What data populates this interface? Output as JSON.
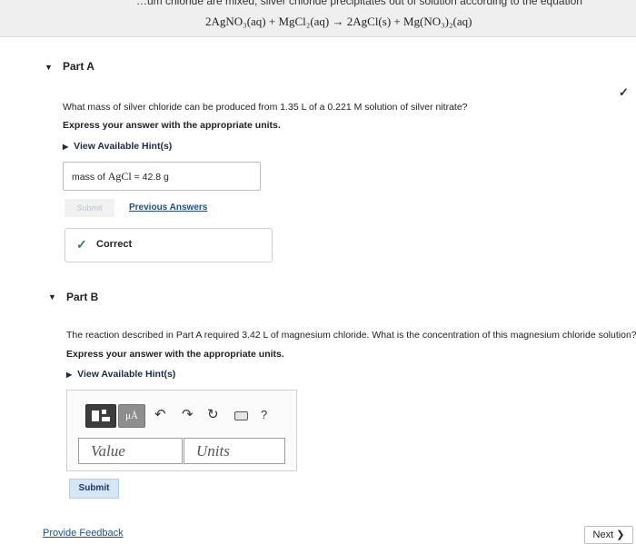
{
  "header": {
    "intro_text": "…um chloride are mixed, silver chloride precipitates out of solution according to the equation",
    "equation": "2AgNO₃(aq) + MgCl₂(aq) → 2AgCl(s) + Mg(NO₃)₂(aq)"
  },
  "part_a": {
    "title": "Part A",
    "question": "What mass of silver chloride can be produced from 1.35 L of a 0.221 M solution of silver nitrate?",
    "instructions": "Express your answer with the appropriate units.",
    "hint_link": "View Available Hint(s)",
    "answer_label": "mass of ",
    "answer_formula": "AgCl",
    "answer_value": " =  42.8 g",
    "submit_label": "Submit",
    "previous_answers_label": "Previous Answers",
    "result_label": "Correct",
    "check_icon": "✓"
  },
  "part_b": {
    "title": "Part B",
    "question": "The reaction described in Part A required 3.42 L of magnesium chloride. What is the concentration of this magnesium chloride solution?",
    "instructions": "Express your answer with the appropriate units.",
    "hint_link": "View Available Hint(s)",
    "toolbar": {
      "units_label": "μÅ",
      "undo_icon": "↶",
      "redo_icon": "↷",
      "reset_icon": "↻",
      "help_label": "?"
    },
    "value_placeholder": "Value",
    "units_placeholder": "Units",
    "submit_label": "Submit"
  },
  "footer": {
    "feedback_link": "Provide Feedback",
    "next_label": "Next ❯"
  }
}
